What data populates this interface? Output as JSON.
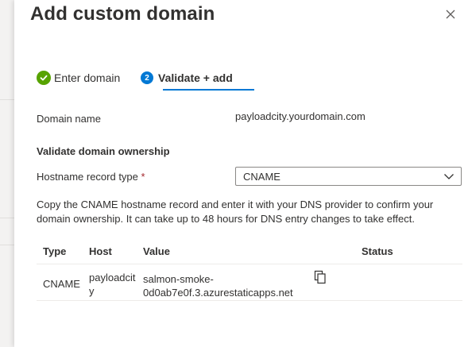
{
  "dialog": {
    "title": "Add custom domain"
  },
  "steps": [
    {
      "label": "Enter domain",
      "state": "complete"
    },
    {
      "number": "2",
      "label": "Validate + add",
      "state": "active"
    }
  ],
  "form": {
    "domain_name_label": "Domain name",
    "domain_name_value": "payloadcity.yourdomain.com",
    "section_title": "Validate domain ownership",
    "record_type_label": "Hostname record type",
    "required_marker": "*",
    "record_type_value": "CNAME",
    "description": "Copy the CNAME hostname record and enter it with your DNS provider to confirm your domain ownership. It can take up to 48 hours for DNS entry changes to take effect."
  },
  "table": {
    "headers": [
      "Type",
      "Host",
      "Value",
      "Status"
    ],
    "rows": [
      {
        "type": "CNAME",
        "host_line1": "payloadcit",
        "host_line2": "y",
        "value_line1": "salmon-smoke-",
        "value_line2": "0d0ab7e0f.3.azurestaticapps.net",
        "status": ""
      }
    ]
  },
  "colors": {
    "accent": "#0078d4",
    "success": "#57a300",
    "required": "#a4262c"
  },
  "icons": [
    "close-icon",
    "checkmark-icon",
    "chevron-down-icon",
    "copy-icon"
  ]
}
